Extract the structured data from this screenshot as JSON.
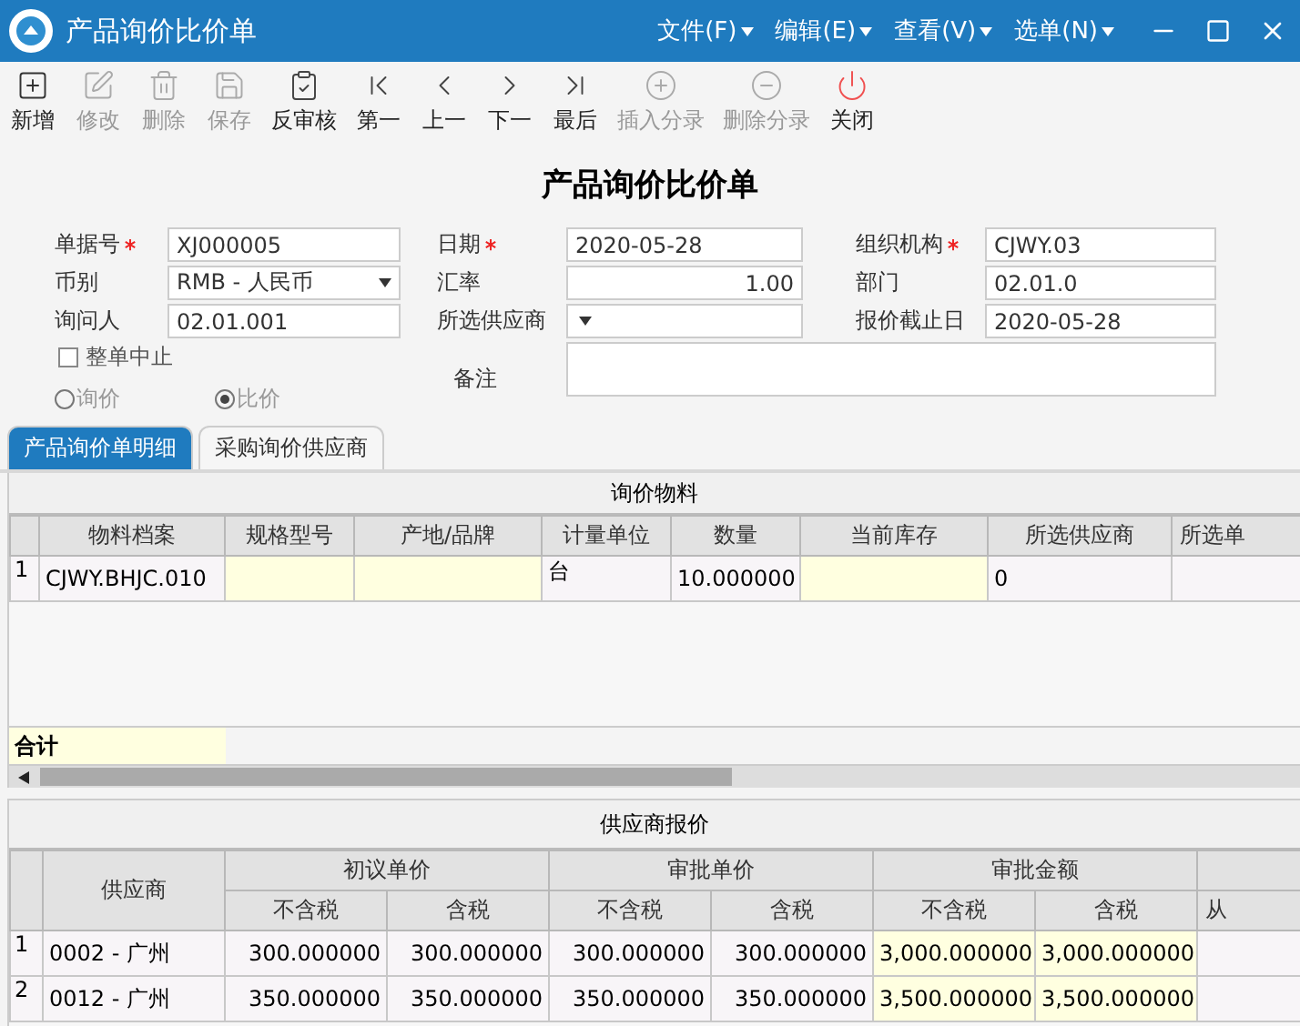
{
  "window": {
    "title": "产品询价比价单",
    "menus": [
      "文件(F)",
      "编辑(E)",
      "查看(V)",
      "选单(N)"
    ]
  },
  "toolbar": [
    {
      "label": "新增",
      "kind": "new",
      "disabled": false
    },
    {
      "label": "修改",
      "kind": "edit",
      "disabled": true
    },
    {
      "label": "删除",
      "kind": "delete",
      "disabled": true
    },
    {
      "label": "保存",
      "kind": "save",
      "disabled": true
    },
    {
      "label": "反审核",
      "kind": "audit",
      "disabled": false
    },
    {
      "label": "第一",
      "kind": "first",
      "disabled": false
    },
    {
      "label": "上一",
      "kind": "prev",
      "disabled": false
    },
    {
      "label": "下一",
      "kind": "next",
      "disabled": false
    },
    {
      "label": "最后",
      "kind": "last",
      "disabled": false
    },
    {
      "label": "插入分录",
      "kind": "insert",
      "disabled": true
    },
    {
      "label": "删除分录",
      "kind": "remove",
      "disabled": true
    },
    {
      "label": "关闭",
      "kind": "close",
      "disabled": false
    }
  ],
  "form": {
    "title": "产品询价比价单",
    "fields": [
      {
        "label": "单据号",
        "required": true,
        "kind": "text",
        "value": "XJ000005"
      },
      {
        "label": "日期",
        "required": true,
        "kind": "text",
        "value": "2020-05-28"
      },
      {
        "label": "组织机构",
        "required": true,
        "kind": "text",
        "value": "CJWY.03"
      },
      {
        "label": "币别",
        "required": false,
        "kind": "select",
        "value": "RMB - 人民币"
      },
      {
        "label": "汇率",
        "required": false,
        "kind": "number",
        "value": "1.00"
      },
      {
        "label": "部门",
        "required": false,
        "kind": "text",
        "value": "02.01.0"
      },
      {
        "label": "询问人",
        "required": false,
        "kind": "text",
        "value": "02.01.001"
      },
      {
        "label": "所选供应商",
        "required": false,
        "kind": "select"
      },
      {
        "label": "报价截止日",
        "required": false,
        "kind": "text",
        "value": "2020-05-28"
      }
    ],
    "stop": {
      "label": "整单中止",
      "checked": false
    },
    "radios": [
      {
        "label": "询价",
        "selected": false
      },
      {
        "label": "比价",
        "selected": true
      }
    ],
    "note": {
      "label": "备注"
    }
  },
  "tabs": [
    {
      "label": "产品询价单明细",
      "selected": true
    },
    {
      "label": "采购询价供应商",
      "selected": false
    }
  ],
  "materials": {
    "title": "询价物料",
    "columns": [
      {
        "label": "物料档案",
        "highlight": false
      },
      {
        "label": "规格型号",
        "highlight": true
      },
      {
        "label": "产地/品牌",
        "highlight": true
      },
      {
        "label": "计量单位",
        "highlight": false
      },
      {
        "label": "数量",
        "highlight": false
      },
      {
        "label": "当前库存",
        "highlight": true
      },
      {
        "label": "所选供应商",
        "highlight": false
      },
      {
        "label": "所选单",
        "highlight": false
      }
    ],
    "rows": [
      {
        "number": "1",
        "cells": [
          "CJWY.BHJC.010",
          "",
          "",
          "台",
          "10.000000",
          "",
          "0",
          ""
        ]
      }
    ],
    "total_label": "合计"
  },
  "quotes": {
    "title": "供应商报价",
    "supplier_header": "供应商",
    "groups": [
      {
        "label": "初议单价",
        "highlight": false,
        "subheaders": [
          "不含税",
          "含税"
        ]
      },
      {
        "label": "审批单价",
        "highlight": false,
        "subheaders": [
          "不含税",
          "含税"
        ]
      },
      {
        "label": "审批金额",
        "highlight": true,
        "subheaders": [
          "不含税",
          "含税"
        ]
      }
    ],
    "column_9": "从",
    "rows": [
      {
        "number": "1",
        "supplier": "0002 - 广州",
        "values": [
          "300.000000",
          "300.000000",
          "300.000000",
          "300.000000",
          "3,000.000000",
          "3,000.000000"
        ]
      },
      {
        "number": "2",
        "supplier": "0012 - 广州",
        "values": [
          "350.000000",
          "350.000000",
          "350.000000",
          "350.000000",
          "3,500.000000",
          "3,500.000000"
        ]
      }
    ]
  }
}
